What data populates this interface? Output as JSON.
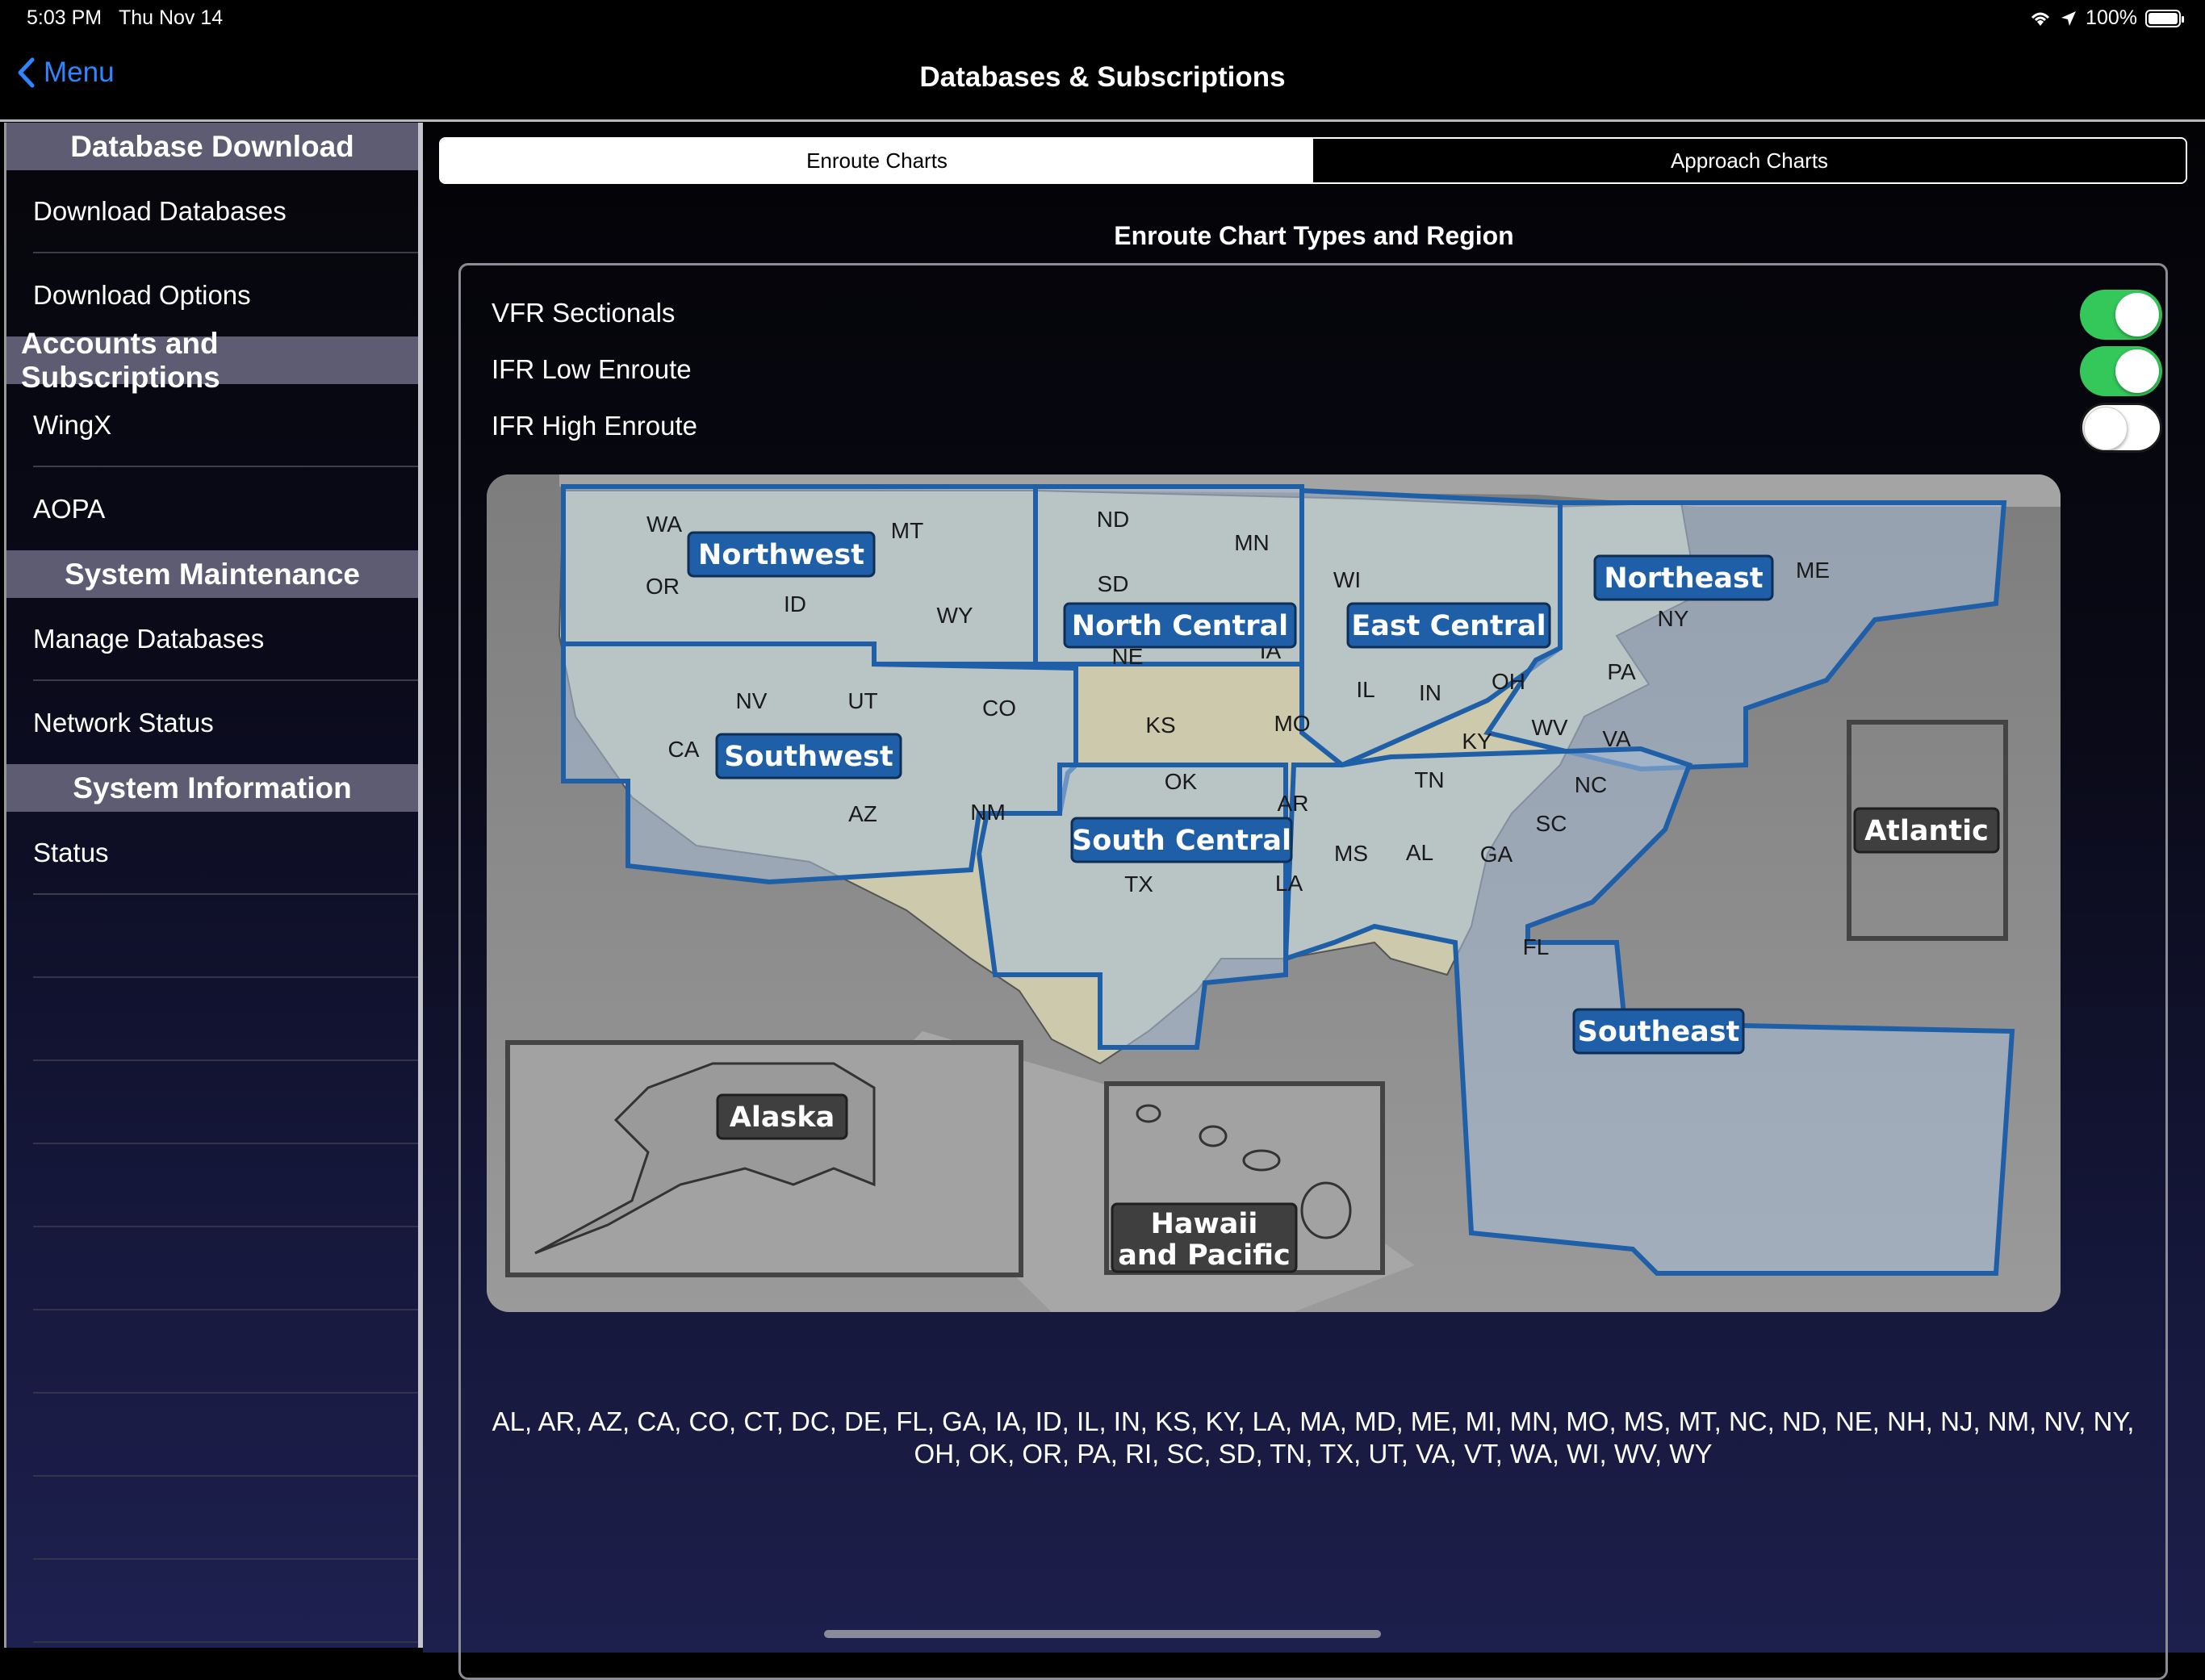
{
  "status_bar": {
    "time": "5:03 PM",
    "date": "Thu Nov 14",
    "battery": "100%"
  },
  "nav": {
    "back_label": "Menu",
    "title": "Databases & Subscriptions"
  },
  "sidebar": {
    "sections": [
      {
        "header": "Database Download",
        "items": [
          "Download Databases",
          "Download Options"
        ]
      },
      {
        "header": "Accounts and Subscriptions",
        "items": [
          "WingX",
          "AOPA"
        ]
      },
      {
        "header": "System Maintenance",
        "items": [
          "Manage Databases",
          "Network Status"
        ]
      },
      {
        "header": "System Information",
        "items": [
          "Status"
        ]
      }
    ]
  },
  "tabs": {
    "active": "Enroute Charts",
    "inactive": "Approach Charts"
  },
  "section_title": "Enroute Chart Types and Region",
  "options": [
    {
      "label": "VFR Sectionals",
      "on": true
    },
    {
      "label": "IFR Low Enroute",
      "on": true
    },
    {
      "label": "IFR High Enroute",
      "on": false
    }
  ],
  "map": {
    "regions": [
      "Northwest",
      "North Central",
      "East Central",
      "Northeast",
      "Southwest",
      "South Central",
      "Southeast",
      "Atlantic",
      "Alaska",
      "Hawaii",
      "and Pacific"
    ],
    "states": [
      "WA",
      "OR",
      "ID",
      "MT",
      "WY",
      "ND",
      "SD",
      "NE",
      "MN",
      "IA",
      "WI",
      "IL",
      "IN",
      "OH",
      "ME",
      "NY",
      "PA",
      "NV",
      "UT",
      "CO",
      "CA",
      "AZ",
      "NM",
      "KS",
      "MO",
      "KY",
      "WV",
      "VA",
      "OK",
      "AR",
      "TN",
      "NC",
      "SC",
      "TX",
      "LA",
      "MS",
      "AL",
      "GA",
      "FL"
    ],
    "colors": {
      "land": "#cfcbb0",
      "region_fill": "#a8c0d8",
      "region_border": "#1f5fa8",
      "label_bg": "#1f5fa8",
      "ocean": "#8f8f8f"
    }
  },
  "states_summary": {
    "line1": "AL, AR, AZ, CA, CO, CT, DC, DE, FL, GA, IA, ID, IL, IN, KS, KY, LA, MA, MD, ME, MI, MN, MO, MS, MT, NC, ND, NE, NH, NJ, NM, NV, NY,",
    "line2": "OH, OK, OR, PA, RI, SC, SD, TN, TX, UT, VA, VT, WA, WI, WV, WY"
  }
}
